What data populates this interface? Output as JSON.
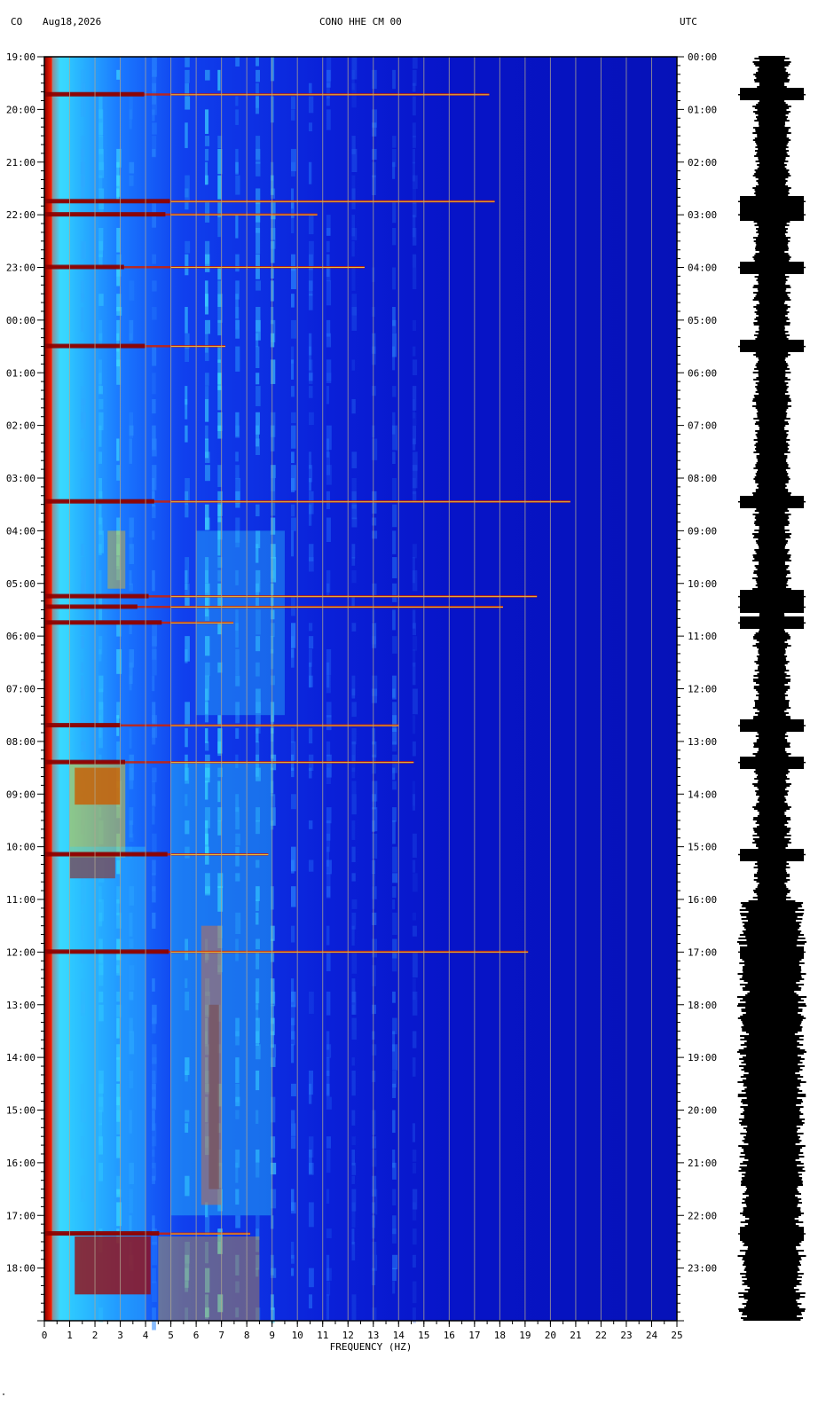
{
  "header": {
    "network": "CO",
    "date": "Aug18,2026",
    "channel": "CONO HHE CM 00",
    "utc_label": "UTC"
  },
  "chart_data": {
    "type": "heatmap",
    "title": "CONO HHE CM 00",
    "xlabel": "FREQUENCY (HZ)",
    "ylabel": "",
    "xlim": [
      0,
      25
    ],
    "x_ticks": [
      0,
      1,
      2,
      3,
      4,
      5,
      6,
      7,
      8,
      9,
      10,
      11,
      12,
      13,
      14,
      15,
      16,
      17,
      18,
      19,
      20,
      21,
      22,
      23,
      24,
      25
    ],
    "ylim_hours": [
      0,
      24
    ],
    "y_left_ticks": [
      "19:00",
      "20:00",
      "21:00",
      "22:00",
      "23:00",
      "00:00",
      "01:00",
      "02:00",
      "03:00",
      "04:00",
      "05:00",
      "06:00",
      "07:00",
      "08:00",
      "09:00",
      "10:00",
      "11:00",
      "12:00",
      "13:00",
      "14:00",
      "15:00",
      "16:00",
      "17:00",
      "18:00"
    ],
    "y_right_ticks": [
      "00:00",
      "01:00",
      "02:00",
      "03:00",
      "04:00",
      "05:00",
      "06:00",
      "07:00",
      "08:00",
      "09:00",
      "10:00",
      "11:00",
      "12:00",
      "13:00",
      "14:00",
      "15:00",
      "16:00",
      "17:00",
      "18:00",
      "19:00",
      "20:00",
      "21:00",
      "22:00",
      "23:00"
    ],
    "grid": true,
    "colormap": [
      "#00008b",
      "#0000ff",
      "#00bfff",
      "#00ffff",
      "#ffff00",
      "#ff0000",
      "#8b0000"
    ],
    "background_level": "#0a10c8",
    "events_utc_hours": [
      0.72,
      2.75,
      3.0,
      4.0,
      5.5,
      8.45,
      10.25,
      10.45,
      10.75,
      12.7,
      13.4,
      15.15,
      17.0,
      22.35
    ]
  },
  "footer": {
    "mark": "\""
  }
}
